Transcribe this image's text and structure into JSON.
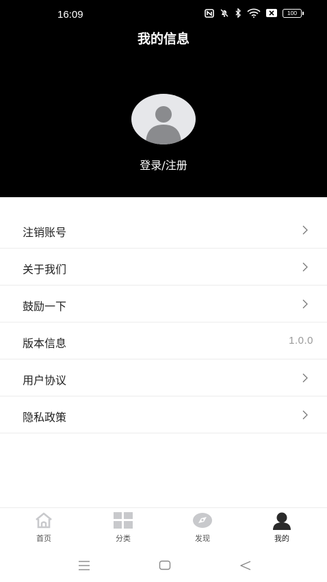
{
  "status_bar": {
    "time": "16:09",
    "battery": "100",
    "icons": [
      "nfc-icon",
      "mute-icon",
      "bluetooth-icon",
      "wifi-icon",
      "sim-icon",
      "battery-icon"
    ]
  },
  "header": {
    "title": "我的信息",
    "login_label": "登录/注册"
  },
  "menu": {
    "items": [
      {
        "label": "注销账号"
      },
      {
        "label": "关于我们"
      },
      {
        "label": "鼓励一下"
      },
      {
        "label": "版本信息",
        "value": "1.0.0"
      },
      {
        "label": "用户协议"
      },
      {
        "label": "隐私政策"
      }
    ]
  },
  "tabbar": {
    "tabs": [
      {
        "label": "首页",
        "icon": "home-icon"
      },
      {
        "label": "分类",
        "icon": "grid-icon"
      },
      {
        "label": "发现",
        "icon": "compass-icon"
      },
      {
        "label": "我的",
        "icon": "person-icon",
        "active": true
      }
    ]
  },
  "colors": {
    "header_bg": "#000000",
    "divider": "#ececec",
    "avatar_bg": "#e6e7ea",
    "icon_gray": "#c8c9cc"
  }
}
